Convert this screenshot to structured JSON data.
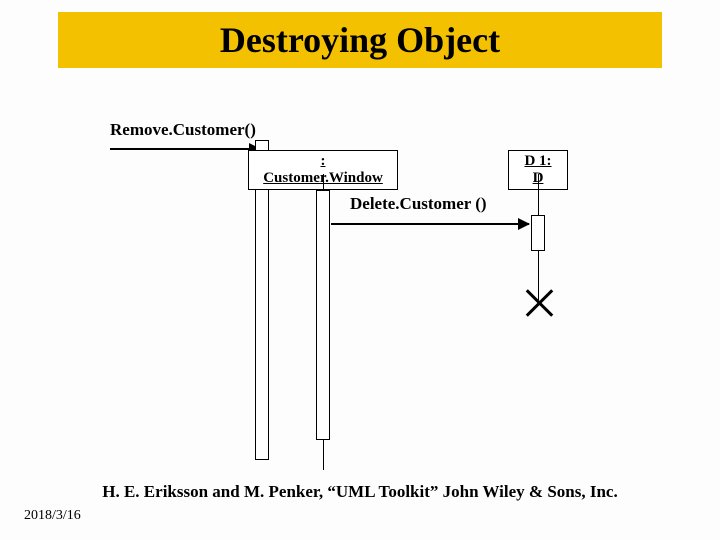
{
  "title": "Destroying Object",
  "messages": {
    "remove": "Remove.Customer()",
    "delete": "Delete.Customer ()"
  },
  "objects": {
    "customerWindow": ": Customer.Window",
    "d1": "D 1: D"
  },
  "citation": "H. E. Eriksson and M. Penker, “UML Toolkit” John Wiley & Sons, Inc.",
  "date": "2018/3/16"
}
